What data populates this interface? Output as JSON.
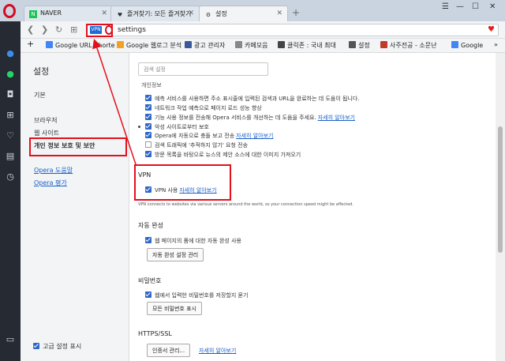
{
  "tabs": [
    {
      "title": "NAVER",
      "icon": "naver-icon",
      "icon_color": "#19c654"
    },
    {
      "title": "즐겨찾기: 모든 즐겨찾기",
      "icon": "heart-icon"
    },
    {
      "title": "설정",
      "icon": "gear-icon"
    }
  ],
  "address": {
    "url": "settings",
    "vpn_badge": "VPN"
  },
  "bookmarks": [
    {
      "label": "Google URL Shorte",
      "icon_color": "#4285f4"
    },
    {
      "label": "Google 웹로그 분석",
      "icon_color": "#f4a025"
    },
    {
      "label": "광고 관리자",
      "icon_color": "#3b5998"
    },
    {
      "label": "카페모음",
      "icon_color": "#888888"
    },
    {
      "label": "클릭존 : 국내 최대",
      "icon_color": "#444444"
    },
    {
      "label": "설정",
      "icon_color": "#555555"
    },
    {
      "label": "사주전공 - 소문난",
      "icon_color": "#c0392b"
    },
    {
      "label": "Google",
      "icon_color": "#4285f4"
    }
  ],
  "nav": {
    "title": "설정",
    "items": [
      "기본",
      "브라우저",
      "웹 사이트",
      "개인 정보 보호 및 보안"
    ],
    "links": [
      "Opera 도움말",
      "Opera 평가"
    ],
    "advanced_label": "고급 설정 표시"
  },
  "main": {
    "search_placeholder": "검색 설정",
    "clipped_heading": "개인정보",
    "privacy_rows": [
      {
        "text": "예측 서비스를 사용하면 주소 표시줄에 입력된 검색과 URL을 완료하는 데 도움이 됩니다.",
        "checked": true
      },
      {
        "text": "네트워크 작업 예측으로 페이지 로드 성능 향상",
        "checked": true
      },
      {
        "text": "기능 사용 정보를 전송해 Opera 서비스를 개선하는 데 도움을 주세요.",
        "link": "자세히 알아보기",
        "checked": true
      },
      {
        "text": "악성 사이트로부터 보호",
        "checked": false,
        "bullet": true
      },
      {
        "text": "Opera에 자동으로 충돌 보고 전송",
        "link": "자세히 알아보기",
        "checked": true
      },
      {
        "text": "검색 트래픽에 '추적하지 않기' 요청 전송",
        "checked": false
      },
      {
        "text": "방문 목록을 바탕으로 뉴스의 제안 소스에 대한 이미지 가져오기",
        "checked": true
      }
    ],
    "vpn": {
      "heading": "VPN",
      "option": "VPN 사용",
      "link": "자세히 알아보기",
      "note": "VPN connects to websites via various servers around the world, so your connection speed might be affected."
    },
    "autofill": {
      "heading": "자동 완성",
      "option": "웹 페이지의 폼에 대한 자동 완성 사용",
      "button": "자동 완성 설정 관리"
    },
    "passwords": {
      "heading": "비밀번호",
      "option": "웹에서 입력한 비밀번호를 저장할지 묻기",
      "button": "모든 비밀번호 표시"
    },
    "https": {
      "heading": "HTTPS/SSL",
      "button": "인증서 관리...",
      "link": "자세히 알아보기"
    }
  },
  "colors": {
    "accent": "#2f68c9",
    "annotation": "#e3101c",
    "link": "#1a5fc8"
  }
}
